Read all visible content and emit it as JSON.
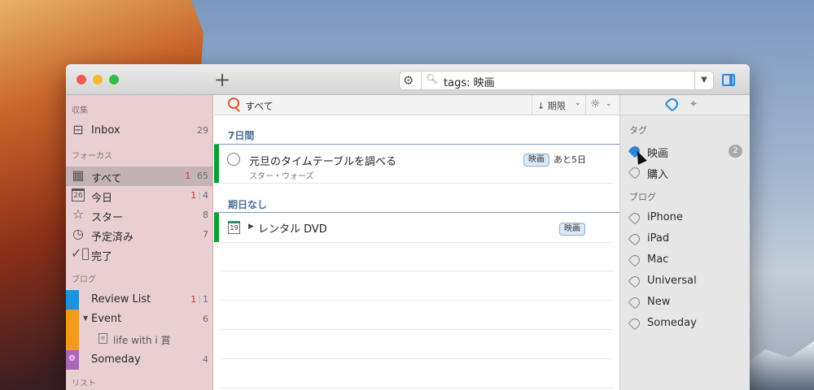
{
  "search": {
    "query": "tags: 映画"
  },
  "sidebar": {
    "section_collect": "収集",
    "inbox": {
      "label": "Inbox",
      "count": "29"
    },
    "section_focus": "フォーカス",
    "all": {
      "label": "すべて",
      "count_red": "1",
      "count": "65"
    },
    "today": {
      "label": "今日",
      "count_red": "1",
      "count": "4",
      "icon_day": "26"
    },
    "starred": {
      "label": "スター",
      "count": "8"
    },
    "scheduled": {
      "label": "予定済み",
      "count": "7"
    },
    "done": {
      "label": "完了"
    },
    "section_blog": "ブログ",
    "review": {
      "label": "Review List",
      "count_red": "1",
      "count": "1"
    },
    "event": {
      "label": "Event",
      "count": "6"
    },
    "lifewith": {
      "label": "life with i 賞"
    },
    "someday": {
      "label": "Someday",
      "count": "4"
    },
    "section_list": "リスト",
    "colors": {
      "review": "#1a93e0",
      "event": "#f39a1a",
      "someday": "#a86ab8",
      "selected": "#c4b3b5"
    }
  },
  "main": {
    "toolbar": {
      "label": "すべて",
      "sort": "↓ 期限"
    },
    "group1": "7日間",
    "task1": {
      "title": "元旦のタイムテーブルを調べる",
      "subtitle": "スター・ウォーズ",
      "tag": "映画",
      "due": "あと5日"
    },
    "group2": "期日なし",
    "task2": {
      "title": "レンタル DVD",
      "tag": "映画",
      "cal_day": "19"
    },
    "accent_color": "#0aa12b"
  },
  "right": {
    "section_tags": "タグ",
    "tag_movie": {
      "label": "映画",
      "count": "2"
    },
    "tag_buy": {
      "label": "購入"
    },
    "section_blog": "ブログ",
    "blog_tags": [
      "iPhone",
      "iPad",
      "Mac",
      "Universal",
      "New",
      "Someday"
    ]
  }
}
